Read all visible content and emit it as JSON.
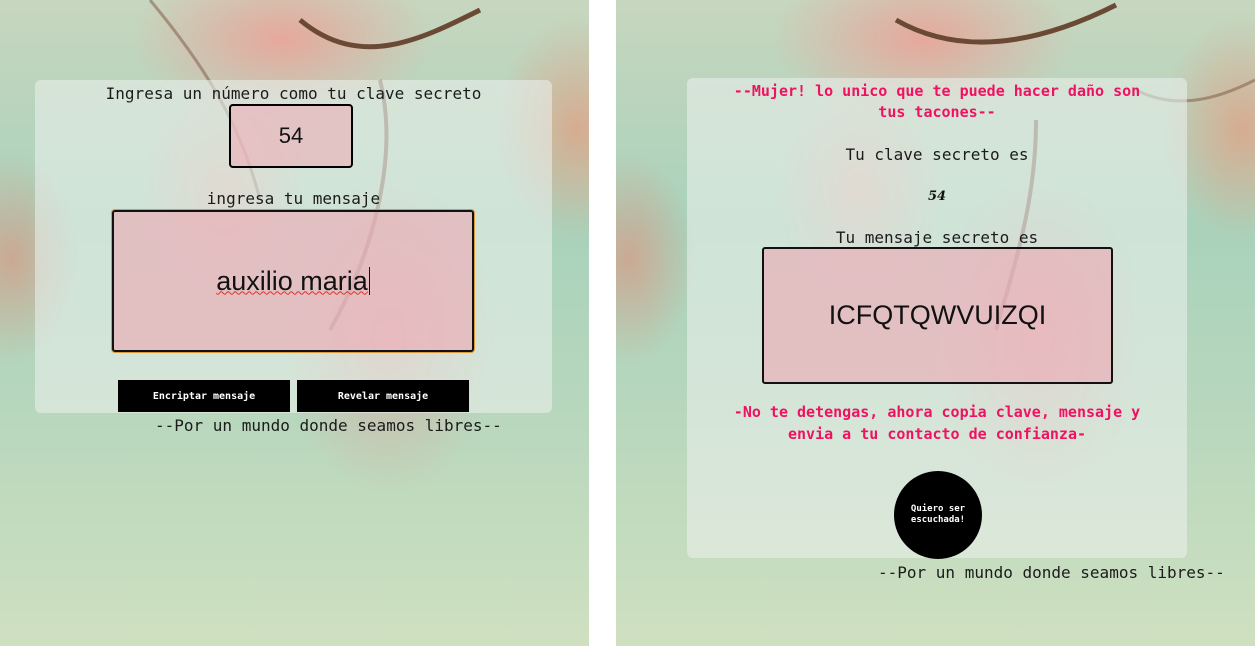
{
  "encrypt_screen": {
    "key_prompt": "Ingresa un número como tu clave secreto",
    "key_value": "54",
    "message_prompt": "ingresa tu mensaje",
    "message_value": "auxilio maria",
    "encrypt_button": "Encriptar mensaje",
    "reveal_button": "Revelar mensaje",
    "footer": "--Por un mundo donde seamos libres--"
  },
  "result_screen": {
    "heading_line1": "--Mujer! lo unico que te puede hacer daño son",
    "heading_line2": "tus tacones--",
    "key_label": "Tu clave secreto es",
    "key_value": "54",
    "message_label": "Tu mensaje secreto es",
    "encrypted_message": "ICFQTQWVUIZQI",
    "instruction_line1": "-No te detengas, ahora copia clave, mensaje y",
    "instruction_line2": "envia a tu contacto de confianza-",
    "help_button_line1": "Quiero ser",
    "help_button_line2": "escuchada!",
    "footer": "--Por un mundo donde seamos libres--"
  },
  "colors": {
    "accent_pink": "#ef1262",
    "button_black": "#000000",
    "card_overlay": "rgba(235,240,236,0.58)"
  }
}
